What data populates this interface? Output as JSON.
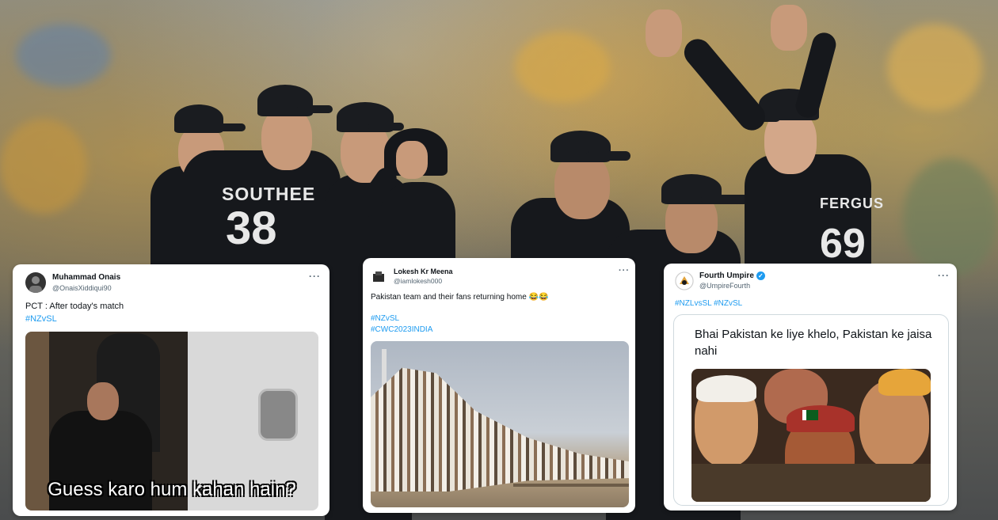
{
  "background": {
    "jersey_name_1": "SOUTHEE",
    "jersey_number_1": "38",
    "jersey_name_2": "FERGUS",
    "jersey_number_2": "69"
  },
  "tweets": [
    {
      "user_name": "Muhammad Onais",
      "handle": "@OnaisXiddiqui90",
      "text": "PCT : After today's match",
      "hashtags": [
        "#NZvSL"
      ],
      "media_caption": "Guess karo hum kahan hain?",
      "verified": false
    },
    {
      "user_name": "Lokesh Kr Meena",
      "handle": "@iamlokesh000",
      "text": "Pakistan team and their fans returning home 😂😂",
      "hashtags": [
        "#NZvSL",
        "#CWC2023INDIA"
      ],
      "verified": false
    },
    {
      "user_name": "Fourth Umpire",
      "handle": "@UmpireFourth",
      "text": "",
      "hashtags": [
        "#NZLvsSL #NZvSL"
      ],
      "quote_text": "Bhai Pakistan ke liye khelo, Pakistan ke jaisa nahi",
      "verified": true
    }
  ],
  "menu_icon": "more-dots",
  "colors": {
    "hashtag": "#1d9bf0",
    "verified": "#1d9bf0"
  }
}
